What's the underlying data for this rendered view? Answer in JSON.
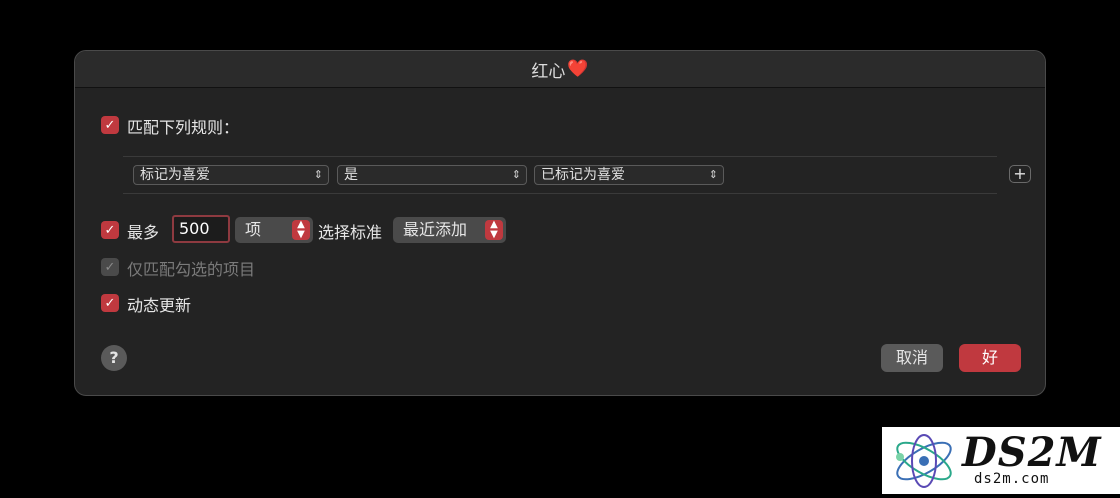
{
  "dialog": {
    "title": "红心",
    "title_emoji": "❤️"
  },
  "match_rules": {
    "checked": true,
    "label": "匹配下列规则："
  },
  "rule": {
    "field": "标记为喜爱",
    "operator": "是",
    "value": "已标记为喜爱",
    "add_label": "+"
  },
  "limit": {
    "checked": true,
    "label": "最多",
    "value": "500",
    "unit": "项",
    "select_by_label": "选择标准",
    "select_by_value": "最近添加"
  },
  "checked_only": {
    "checked": true,
    "enabled": false,
    "label": "仅匹配勾选的项目"
  },
  "live_update": {
    "checked": true,
    "label": "动态更新"
  },
  "buttons": {
    "help": "?",
    "cancel": "取消",
    "ok": "好"
  },
  "watermark": {
    "brand": "DS2M",
    "domain": "ds2m.com"
  },
  "colors": {
    "accent": "#c0393f",
    "background": "#232323"
  }
}
